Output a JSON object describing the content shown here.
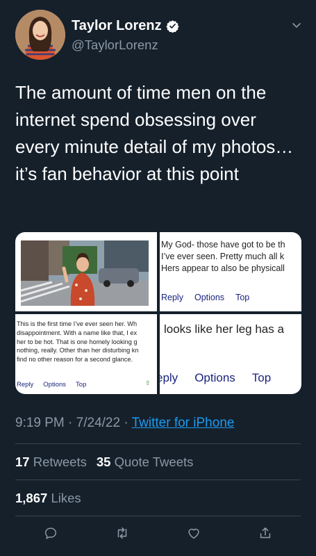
{
  "author": {
    "name": "Taylor Lorenz",
    "handle": "@TaylorLorenz"
  },
  "tweet": {
    "text": "The amount of time men on the internet spend obsessing over every minute detail of my photos… it’s fan behavior at this point"
  },
  "media": {
    "comment_top_right": {
      "lines": [
        "My God- those have got to be th",
        "I’ve ever seen. Pretty much all k",
        "Hers appear to also be physicall"
      ],
      "links": [
        "Reply",
        "Options",
        "Top"
      ]
    },
    "comment_bottom_left": {
      "lines": [
        "This is the first time I’ve ever seen her. Wh",
        "disappointment. With a name like that, I ex",
        "her to be hot. That is one homely looking g",
        "nothing, really. Other than her disturbing kn",
        "find no other reason for a second glance."
      ],
      "links": [
        "Reply",
        "Options",
        "Top"
      ]
    },
    "comment_bottom_right": {
      "text": "looks like her leg has a",
      "links": [
        "eply",
        "Options",
        "Top"
      ]
    }
  },
  "meta": {
    "time": "9:19 PM",
    "separator": "·",
    "date": "7/24/22",
    "source": "Twitter for iPhone"
  },
  "stats": {
    "retweets_count": "17",
    "retweets_label": "Retweets",
    "quotes_count": "35",
    "quotes_label": "Quote Tweets",
    "likes_count": "1,867",
    "likes_label": "Likes"
  },
  "colors": {
    "background": "#15202b",
    "secondary_text": "#8b98a5",
    "link": "#1d9bf0",
    "divider": "#38444d"
  },
  "icons": [
    "verified-badge-icon",
    "chevron-down-icon",
    "reply-icon",
    "retweet-icon",
    "like-icon",
    "share-icon"
  ]
}
